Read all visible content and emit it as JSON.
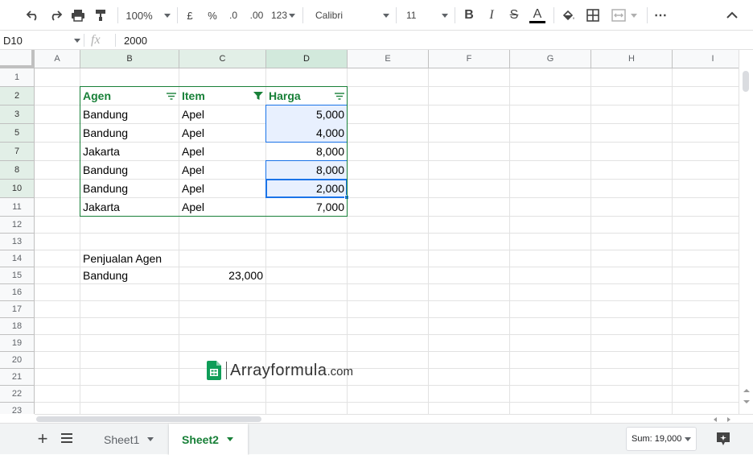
{
  "toolbar": {
    "zoom": "100%",
    "currency": "£",
    "percent": "%",
    "dec_decrease": ".0",
    "dec_increase": ".00",
    "more_formats": "123",
    "font": "Calibri",
    "font_size": "11",
    "bold": "B",
    "italic": "I",
    "strike": "S",
    "text_color_letter": "A",
    "text_color": "#000000",
    "more": "⋯"
  },
  "formula_bar": {
    "name_box": "D10",
    "fx": "fx",
    "value": "2000"
  },
  "columns": [
    "A",
    "B",
    "C",
    "D",
    "E",
    "F",
    "G",
    "H",
    "I"
  ],
  "rows": [
    "1",
    "2",
    "3",
    "5",
    "7",
    "8",
    "10",
    "11",
    "12",
    "13",
    "14",
    "15",
    "16",
    "17",
    "18",
    "19",
    "20",
    "21",
    "22",
    "23"
  ],
  "table": {
    "headers": [
      "Agen",
      "Item",
      "Harga"
    ],
    "rows": [
      [
        "Bandung",
        "Apel",
        "5,000"
      ],
      [
        "Bandung",
        "Apel",
        "4,000"
      ],
      [
        "Jakarta",
        "Apel",
        "8,000"
      ],
      [
        "Bandung",
        "Apel",
        "8,000"
      ],
      [
        "Bandung",
        "Apel",
        "2,000"
      ],
      [
        "Jakarta",
        "Apel",
        "7,000"
      ]
    ]
  },
  "summary": {
    "label": "Penjualan Agen",
    "agent": "Bandung",
    "total": "23,000"
  },
  "watermark": {
    "brand": "Arrayformula",
    "suffix": ".com"
  },
  "sheets": [
    "Sheet1",
    "Sheet2"
  ],
  "active_sheet": "Sheet2",
  "status": {
    "sum": "Sum: 19,000"
  },
  "colors": {
    "accent_green": "#188038",
    "selection_blue": "#1a73e8",
    "selection_fill": "#e8f0fe"
  }
}
